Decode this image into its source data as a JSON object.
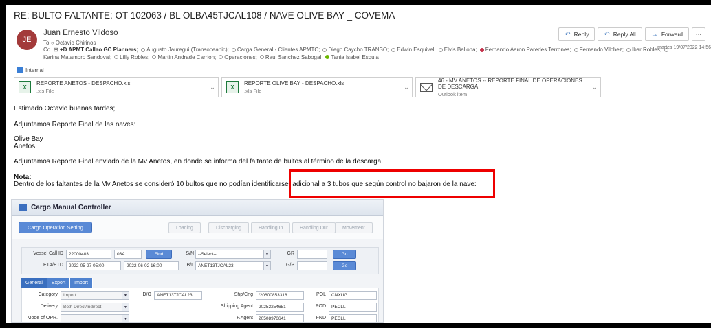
{
  "email": {
    "subject": "RE: BULTO FALTANTE: OT 102063 / BL OLBA45TJCAL108 / NAVE OLIVE BAY _ COVEMA",
    "avatar_initials": "JE",
    "sender": "Juan Ernesto Vildoso",
    "to_label": "To",
    "to": "Octavio Chirinos",
    "cc_label": "Cc",
    "cc": [
      {
        "name": "+D APMT Callao GC Planners;",
        "presence": "group",
        "bold": true
      },
      {
        "name": "Augusto Jauregui (Transoceanic);",
        "presence": "none"
      },
      {
        "name": "Carga General - Clientes APMTC;",
        "presence": "none"
      },
      {
        "name": "Diego Caycho TRANSO;",
        "presence": "none"
      },
      {
        "name": "Edwin Esquivel;",
        "presence": "none"
      },
      {
        "name": "Elvis Ballona;",
        "presence": "none"
      },
      {
        "name": "Fernando Aaron Paredes Terrones;",
        "presence": "busy"
      },
      {
        "name": "Fernando Vilchez;",
        "presence": "none"
      },
      {
        "name": "Ibar Robles;",
        "presence": "none"
      },
      {
        "name": "Karina Matamoro Sandoval;",
        "presence": "none"
      },
      {
        "name": "Lilly Robles;",
        "presence": "none"
      },
      {
        "name": "Martin Andrade Carrion;",
        "presence": "none"
      },
      {
        "name": "Operaciones;",
        "presence": "none"
      },
      {
        "name": "Raul Sanchez Sabogal;",
        "presence": "none"
      },
      {
        "name": "Tania Isabel Esquia",
        "presence": "ok"
      }
    ],
    "actions": {
      "reply": "Reply",
      "reply_all": "Reply All",
      "forward": "Forward",
      "more": "···"
    },
    "date": "martes 19/07/2022 14:56",
    "label_internal": "Internal",
    "attachments": [
      {
        "name": "REPORTE ANETOS - DESPACHO.xls",
        "type": ".xls File",
        "icon": "excel-icon"
      },
      {
        "name": "REPORTE OLIVE BAY - DESPACHO.xls",
        "type": ".xls File",
        "icon": "excel-icon"
      },
      {
        "name": "46.- MV ANETOS -- REPORTE FINAL DE OPERACIONES DE DESCARGA",
        "type": "Outlook item",
        "icon": "mail-icon"
      }
    ],
    "body": {
      "greeting": "Estimado Octavio buenas tardes;",
      "p1": "Adjuntamos Reporte Final de las naves:",
      "ship1": "Olive Bay",
      "ship2": "Anetos",
      "p2": "Adjuntamos Reporte Final enviado de la Mv Anetos, en donde se informa del faltante de bultos al término de la descarga.",
      "nota_label": "Nota:",
      "nota_text": "Dentro de los faltantes de la Mv Anetos se consideró 10 bultos que no podían identificarse, adicional a 3 tubos que según control no bajaron de la nave:"
    }
  },
  "app": {
    "title": "Cargo Manual Controller",
    "btn_setting": "Cargo Operation Setting",
    "buttons": [
      "Loading",
      "Discharging",
      "Handling In",
      "Handling Out",
      "Movement"
    ],
    "vessel_call_id_label": "Vessel Call ID",
    "vessel_call_id": "22000403",
    "vessel_code": "03A",
    "find": "Find",
    "etaetd_label": "ETA/ETD",
    "eta": "2022-05-27 05:00",
    "etd": "2022-06-02 16:00",
    "sn_label": "S/N",
    "sn_value": "--Select--",
    "bl_label": "B/L",
    "bl_value": "ANET13TJCAL23",
    "gr_label": "GR",
    "gp_label": "G/P",
    "go": "Go",
    "tabs": [
      "General",
      "Export",
      "Import"
    ],
    "category_label": "Category",
    "category_value": "Import",
    "delivery_label": "Delivery",
    "delivery_value": "Both Direct/Indirect",
    "mode_label": "Mode of OPR.",
    "do_label": "D/O",
    "do_value": "ANET13TJCAL23",
    "shpcng_label": "Shp/Cng",
    "shpcng_value": "/20600853318",
    "shipping_agent_label": "Shipping Agent",
    "shipping_agent_value": "20252254651",
    "fagent_label": "F.Agent",
    "fagent_value": "20508976641",
    "pol_label": "POL",
    "pol_value": "CNXUG",
    "pod_label": "POD",
    "pod_value": "PECLL",
    "fnd_label": "FND",
    "fnd_value": "PECLL"
  },
  "colors": {
    "highlight_box": "#e00000",
    "avatar": "#a33a3a",
    "app_button": "#5a8ad6"
  }
}
